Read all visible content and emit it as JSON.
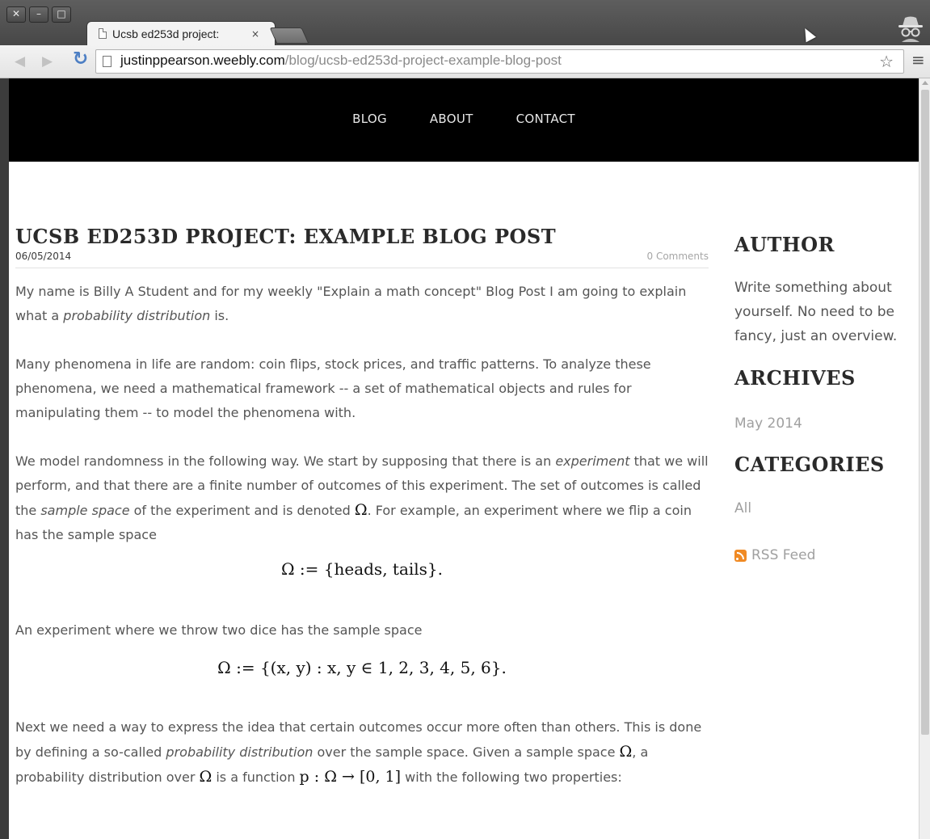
{
  "browser": {
    "window_buttons": [
      "✕",
      "–",
      "□"
    ],
    "tab": {
      "title": "Ucsb ed253d project:",
      "close": "×"
    },
    "url": {
      "host": "justinppearson.weebly.com",
      "path": "/blog/ucsb-ed253d-project-example-blog-post"
    }
  },
  "site": {
    "nav": [
      "BLOG",
      "ABOUT",
      "CONTACT"
    ]
  },
  "post": {
    "title": "UCSB ED253D PROJECT: EXAMPLE BLOG POST",
    "date": "06/05/2014",
    "comments": "0 Comments",
    "p1": {
      "a": "My name is Billy A Student and for my weekly \"Explain a math concept\" Blog Post I am going to explain what a ",
      "em": "probability distribution",
      "b": " is."
    },
    "p2": "Many phenomena in life are random: coin flips, stock prices, and traffic patterns. To analyze these phenomena, we need a mathematical framework -- a set of mathematical objects and rules for manipulating them -- to model the phenomena with.",
    "p3": {
      "a": "We model randomness in the following way. We start by supposing that there is an ",
      "em1": "experiment",
      "b": " that we will perform, and that there are a finite number of outcomes of this experiment. The set of outcomes is called the ",
      "em2": "sample space",
      "c": " of the experiment and is denoted ",
      "math": "Ω",
      "d": ". For example, an experiment where we flip a coin has the sample space"
    },
    "eq1": "Ω := {heads, tails}.",
    "p4": "An experiment where we throw two dice has the sample space",
    "eq2": "Ω := {(x, y)  :  x, y ∈ 1, 2, 3, 4, 5, 6}.",
    "p5": {
      "a": "Next we need a way to express the idea that certain outcomes occur more often than others. This is done by defining a so-called ",
      "em": "probability distribution",
      "b": " over the sample space. Given a sample space ",
      "m1": "Ω",
      "c": ", a probability distribution over ",
      "m2": "Ω",
      "d": " is a function ",
      "m3": "p : Ω → [0, 1]",
      "e": " with the following two properties:"
    }
  },
  "sidebar": {
    "author_heading": "AUTHOR",
    "author_text": "Write something about yourself. No need to be fancy, just an overview.",
    "archives_heading": "ARCHIVES",
    "archives_link": "May 2014",
    "categories_heading": "CATEGORIES",
    "categories_link": "All",
    "rss": "RSS Feed"
  },
  "colors": {
    "header_bg": "#000000",
    "rss_orange": "#f08a24",
    "reload_blue": "#4d7fc4"
  }
}
